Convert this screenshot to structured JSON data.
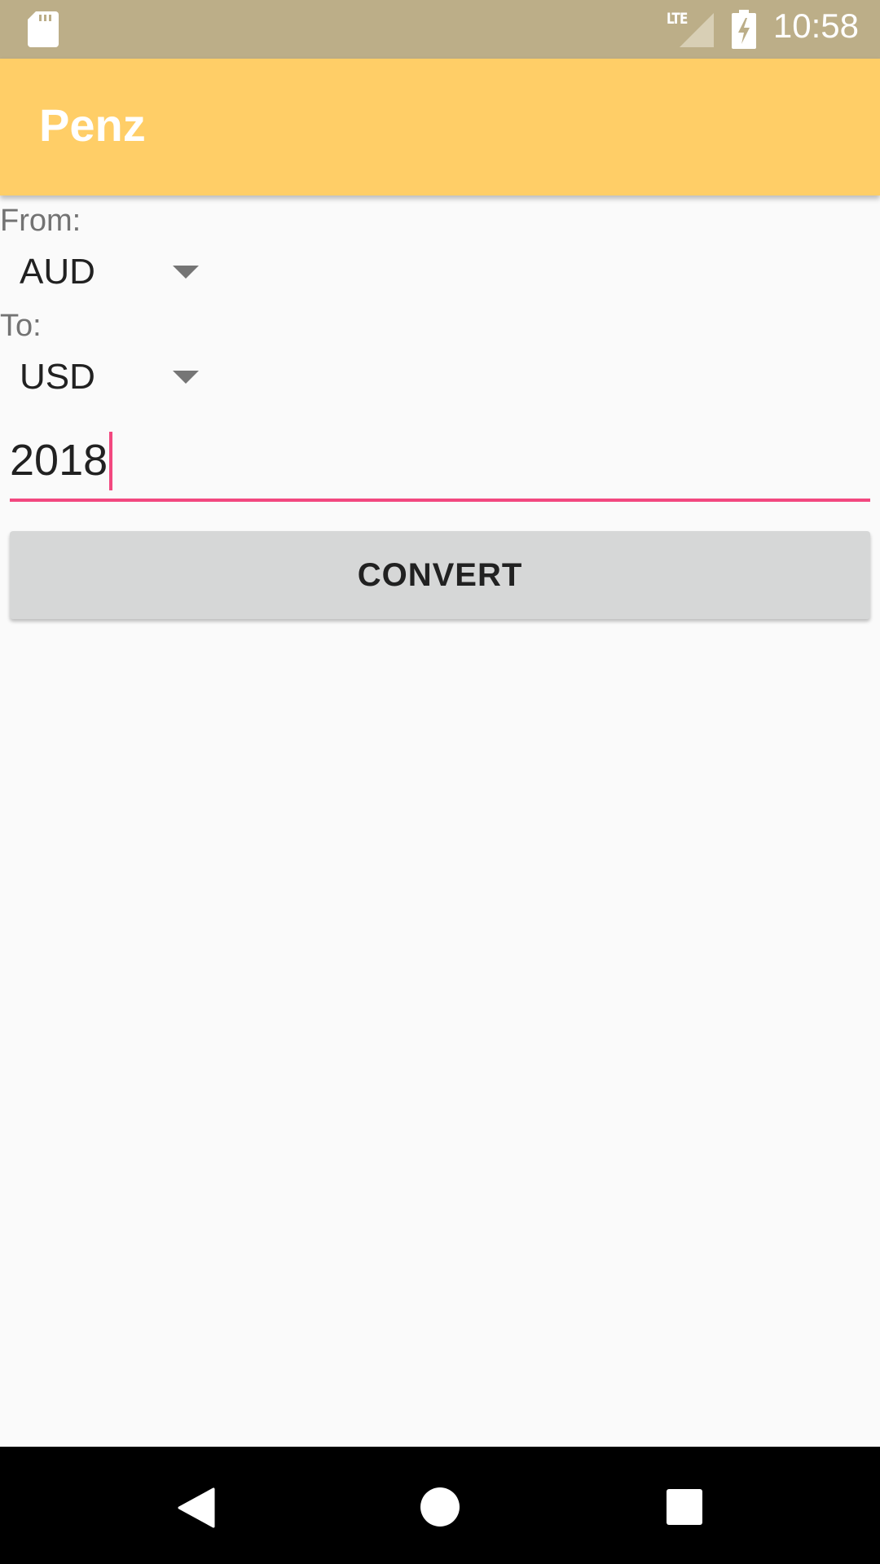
{
  "status_bar": {
    "time": "10:58",
    "network_label": "LTE",
    "icons": [
      "sd-card-icon",
      "lte-signal-icon",
      "battery-charging-icon"
    ]
  },
  "app_bar": {
    "title": "Penz"
  },
  "form": {
    "from_label": "From:",
    "from_value": "AUD",
    "to_label": "To:",
    "to_value": "USD",
    "amount_value": "2018",
    "convert_label": "CONVERT"
  },
  "nav_bar": {
    "icons": [
      "back-icon",
      "home-icon",
      "recents-icon"
    ]
  },
  "colors": {
    "status_bar": "#bcae88",
    "app_bar": "#ffce67",
    "accent": "#f2487f",
    "background": "#fafafa",
    "button": "#d6d7d7"
  }
}
